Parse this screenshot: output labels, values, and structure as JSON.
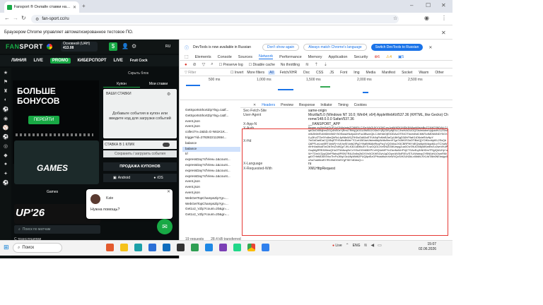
{
  "browser": {
    "tab_title": "Fansport ® Онлайн ставки на спорт",
    "url": "fan-sport.cc/ru",
    "infobar": "Браузером Chrome управляет автоматизированное тестовое ПО."
  },
  "site": {
    "logo_a": "FAN",
    "logo_b": "SPORT",
    "balance_label": "Основной (UAH)",
    "balance_value": "413.08",
    "lang": "RU",
    "fruit": "Fruit Cock",
    "menu": [
      "ЛИНИЯ",
      "LIVE",
      "PROMO",
      "КИБЕРСПОРТ",
      "LIVE"
    ],
    "banner_text": "БОЛЬШЕ БОНУСОВ",
    "banner_button": "ПЕРЕЙТИ",
    "games_label": "GAMES",
    "games_caption": "Games",
    "promo2": "UP'26",
    "search_placeholder": "Поиск по матчам",
    "translations": "С трансляциями"
  },
  "slip": {
    "title": "Скрыть блок",
    "tab_coupon": "Купон",
    "tab_mystakes": "Мои ставки",
    "my_stakes": "ВАШИ СТАВКИ",
    "empty": "Добавьте события в купон или введите код для загрузки событий",
    "one_click": "СТАВКА В 1 КЛИК",
    "save": "Сохранить / загрузить события",
    "sales": "ПРОДАЖА КУПОНОВ",
    "android": "Android",
    "ios": "iOS"
  },
  "chat": {
    "name": "Kate",
    "message": "Нужна помощь?"
  },
  "devtools": {
    "notice": "DevTools is now available in Russian",
    "btn_dont": "Don't show again",
    "btn_match": "Always match Chrome's language",
    "btn_switch": "Switch DevTools to Russian",
    "tabs": [
      "Elements",
      "Console",
      "Sources",
      "Network",
      "Performance",
      "Memory",
      "Application",
      "Security"
    ],
    "active_tab": "Network",
    "errors": "6",
    "warnings": "4",
    "info": "5",
    "preserve_log": "Preserve log",
    "disable_cache": "Disable cache",
    "throttling": "No throttling",
    "filter_placeholder": "Filter",
    "invert": "Invert",
    "more_filters": "More filters",
    "filters": [
      "All",
      "Fetch/XHR",
      "Doc",
      "CSS",
      "JS",
      "Font",
      "Img",
      "Media",
      "Manifest",
      "Socket",
      "Wasm",
      "Other"
    ],
    "ticks": [
      "500 ms",
      "1,000 ms",
      "1,500 ms",
      "2,000 ms",
      "2,500 ms"
    ],
    "requests": [
      "GetSportsShortZip?lng=1&tf...",
      "GetSportsShortZip?lng=1&tf...",
      "event.json",
      "event.json",
      "collect?v=2&tid=G-N61K1K...",
      "trigger?id=2782822112654...",
      "balance",
      "balance",
      "tr/",
      "expressDay?cfView=1&count...",
      "expressDay?cfView=1&count...",
      "expressDay?cfView=1&count...",
      "expressDay?cfView=1&count...",
      "event.json",
      "event.json",
      "event.json",
      "WebGetTopChampsZip?gr=...",
      "WebGetTopChampsZip?gr=...",
      "Get1x2_VZip?count=20&gr=...",
      "Get1x2_VZip?count=20&gr=..."
    ],
    "selected_request": 7,
    "footer_requests": "19 requests",
    "footer_transferred": "28.4 kB transferred",
    "detail_tabs": [
      "Headers",
      "Preview",
      "Response",
      "Initiator",
      "Timing",
      "Cookies"
    ],
    "active_detail": "Headers",
    "headers": [
      {
        "k": "Sec-Fetch-Site",
        "v": "same-origin"
      },
      {
        "k": "User-Agent",
        "v": "Mozilla/5.0 (Windows NT 10.0; Win64; x64) AppleWebKit/537.36 (KHTML, like Gecko) Chrome/148.0.0.0 Safari/537.36"
      },
      {
        "k": "X-App-N",
        "v": "__FANSPORT_APP"
      },
      {
        "k": "X-Auth",
        "v": "Bearer eyJhbGciOiJFUzI1NiIsImtpZCI6IjEiLCJ0eXAiOiJKV1QifQ.eyJzdWIiOiI1MDk3MjAwMiIsInBpZCI6IjQ3NDAiLCJqdGkiOiI5NjhmZGQ4NS0zYjRmLTRiNjQtOGU5MS02ODk0YjRjZDEyNjEiLCJhcHAiOiJOQSIsImlubmVyIjoidHJ1ZSIsIm5iZiI6MTc4MDM4NDY5OSwiaXNzIjoiZmFuc3BvcnQiLCJleHAiOjE3ODAzOTE4OTksImlhdCI6MTc4MDM4NDY5OX0.y3KvZT2e9Yx8mQbRcL4pN6sW1jTfH0uGdA5oE7iVkXqPzMnB2wCyU8rSgD3lJhF9aK1tO6xIeR4vNpY"
      },
      {
        "k": "X-Hd",
        "v": "7wGdOartDaCQ1BqtTFHSdhxBWa+TCLet1BGdzUtsbm8dyWdfo9hrnH7gz7s3tK0S3oDTlBxIQjYOIKlcvbjdXL2SsQdQ6PFLwLnw5RT4mkFj+/v4VwSIVwtk2IPg2Yl9aB9MAbRtcyPzq7vQGMxzJX5CBRPWYdEQwI6pMI4iqoMLrzTCXaWmHH4slMu8TwCfkTeUXd9QyTJKLK3D1dMIkJErTLwOQGLlXeSNlZOMUmpg2ua0CivS9LtD0l8yMf1e8ht/1v2wnVKdPGuqMgRRE8IXbwQHuOT5A6zqZnCvYt3uOGhM8XPCvHQUeMFYnZlcnNz5/rrP4jCTGAvEqJhNHDmTFfgIQUUHy+uW+TDmX/ZypQ0eFRahq9PiSNTR4LEn8w2bDVVn5CKWSGvhJgOOyvrAlV8dF0Ec/S7U/Wwkxp2YBN0zN1OsmRMigdXTHbMD8XIVkoThrFsJt0qX3cU8yWkf62PUQ6ptEzGPHdaWumXeWVQxSIH2UN3kLxIMdItLRXLfdT8ib0NEbsigo0uSa7xsilI8oWY/R1t9dOGbSYgF3DYdDAsQ=="
      },
      {
        "k": "X-Language",
        "v": "ru"
      },
      {
        "k": "X-Requested-With",
        "v": "XMLHttpRequest"
      }
    ]
  },
  "taskbar": {
    "search": "Поиск",
    "live": "Live",
    "lang": "ENG",
    "time": "15:07",
    "date": "02.06.2026"
  },
  "colors": {
    "brand_green": "#18a945",
    "highlight_red": "#e53935",
    "devtools_blue": "#1a73e8"
  }
}
